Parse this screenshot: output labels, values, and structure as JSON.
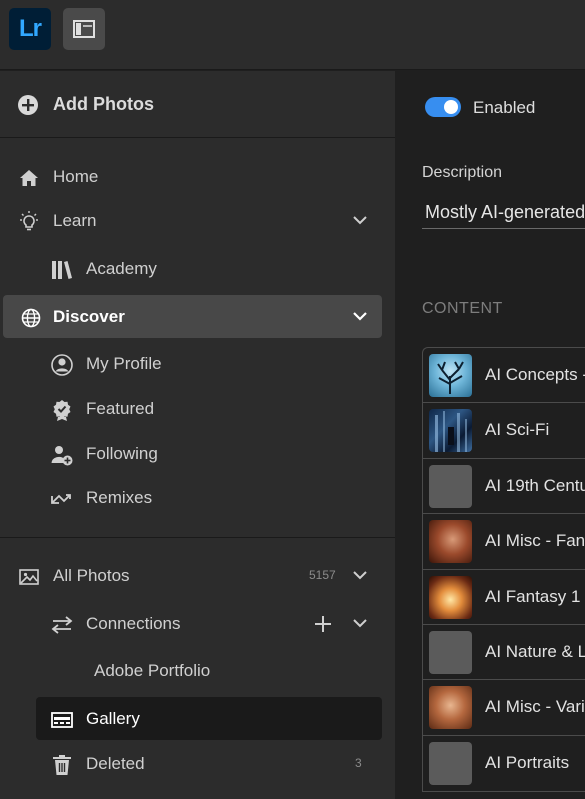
{
  "app": {
    "logo_text": "Lr",
    "accent": "#31a8ff"
  },
  "sidebar": {
    "add_photos": "Add Photos",
    "home": "Home",
    "learn": "Learn",
    "academy": "Academy",
    "discover": "Discover",
    "my_profile": "My Profile",
    "featured": "Featured",
    "following": "Following",
    "remixes": "Remixes",
    "all_photos": "All Photos",
    "all_photos_count": "5157",
    "connections": "Connections",
    "adobe_portfolio": "Adobe Portfolio",
    "gallery": "Gallery",
    "deleted": "Deleted",
    "deleted_count": "3"
  },
  "main": {
    "enabled_label": "Enabled",
    "enabled": true,
    "description_label": "Description",
    "description_value": "Mostly AI-generated",
    "content_label": "CONTENT",
    "content_items": [
      {
        "name": "AI Concepts -",
        "thumb": "tree"
      },
      {
        "name": "AI Sci-Fi",
        "thumb": "scifi"
      },
      {
        "name": "AI 19th Centu",
        "thumb": "blank"
      },
      {
        "name": "AI Misc - Fant",
        "thumb": "portrait-red"
      },
      {
        "name": "AI Fantasy 1",
        "thumb": "light"
      },
      {
        "name": "AI Nature & L",
        "thumb": "blank"
      },
      {
        "name": "AI Misc - Vari",
        "thumb": "portrait-warm"
      },
      {
        "name": "AI Portraits",
        "thumb": "blank"
      }
    ]
  }
}
